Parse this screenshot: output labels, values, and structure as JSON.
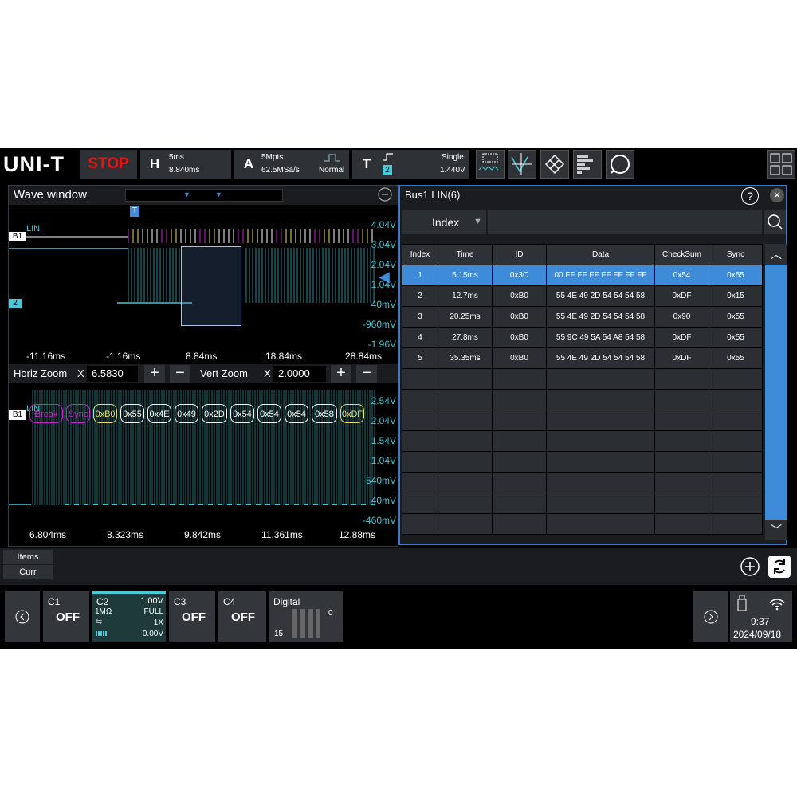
{
  "topbar": {
    "logo": "UNI-T",
    "run_state": "STOP",
    "horizontal": {
      "letter": "H",
      "timebase": "5ms",
      "offset": "8.840ms"
    },
    "acquire": {
      "letter": "A",
      "depth": "5Mpts",
      "rate": "62.5MSa/s",
      "mode": "Normal"
    },
    "trigger": {
      "letter": "T",
      "source": "2",
      "sweep": "Single",
      "level": "1.440V"
    }
  },
  "wave_window": {
    "title": "Wave window",
    "upper": {
      "bus_label": "B1",
      "bus_name": "LIN",
      "ch_label": "2",
      "trigger_marker": "T",
      "y_ticks": [
        "4.04V",
        "3.04V",
        "2.04V",
        "1.04V",
        "40mV",
        "-960mV",
        "-1.96V"
      ],
      "x_ticks": [
        "-11.16ms",
        "-1.16ms",
        "8.84ms",
        "18.84ms",
        "28.84ms"
      ]
    },
    "zoom": {
      "horiz_label": "Horiz Zoom",
      "horiz_x": "X",
      "horiz_value": "6.5830",
      "vert_label": "Vert Zoom",
      "vert_x": "X",
      "vert_value": "2.0000",
      "plus": "+",
      "minus": "−"
    },
    "lower": {
      "bus_label": "B1",
      "bus_name": "LIN",
      "frames": [
        "Break",
        "Sync",
        "0xB0",
        "0x55",
        "0x4E",
        "0x49",
        "0x2D",
        "0x54",
        "0x54",
        "0x54",
        "0x58",
        "0xDF"
      ],
      "y_ticks": [
        "2.54V",
        "2.04V",
        "1.54V",
        "1.04V",
        "540mV",
        "40mV",
        "-460mV"
      ],
      "x_ticks": [
        "6.804ms",
        "8.323ms",
        "9.842ms",
        "11.361ms",
        "12.88ms"
      ]
    }
  },
  "bus_panel": {
    "title": "Bus1 LIN(6)",
    "help": "?",
    "close": "✕",
    "filter_label": "Index",
    "columns": [
      "Index",
      "Time",
      "ID",
      "Data",
      "CheckSum",
      "Sync"
    ],
    "rows": [
      [
        "1",
        "5.15ms",
        "0x3C",
        "00 FF FF FF FF FF FF FF",
        "0x54",
        "0x55"
      ],
      [
        "2",
        "12.7ms",
        "0xB0",
        "55 4E 49 2D 54 54 54 58",
        "0xDF",
        "0x15"
      ],
      [
        "3",
        "20.25ms",
        "0xB0",
        "55 4E 49 2D 54 54 54 58",
        "0x90",
        "0x55"
      ],
      [
        "4",
        "27.8ms",
        "0xB0",
        "55 9C 49 5A 54 A8 54 58",
        "0xDF",
        "0x55"
      ],
      [
        "5",
        "35.35ms",
        "0xB0",
        "55 4E 49 2D 54 54 54 58",
        "0xDF",
        "0x55"
      ]
    ],
    "selected_row": 1
  },
  "bottom": {
    "items_label": "Items",
    "curr_label": "Curr",
    "channels": [
      {
        "name": "C1",
        "state": "OFF"
      },
      {
        "name": "C2",
        "scale": "1.00V",
        "impedance": "1MΩ",
        "bw": "FULL",
        "probe": "1X",
        "offset": "0.00V"
      },
      {
        "name": "C3",
        "state": "OFF"
      },
      {
        "name": "C4",
        "state": "OFF"
      }
    ],
    "digital": {
      "label": "Digital",
      "low": "0",
      "high": "15"
    },
    "time": "9:37",
    "date": "2024/09/18"
  },
  "colors": {
    "cyan": "#48c8d8",
    "magenta": "#d020d0",
    "yellow": "#e8e060",
    "selected": "#3d8bd9",
    "stop": "#e11111"
  }
}
